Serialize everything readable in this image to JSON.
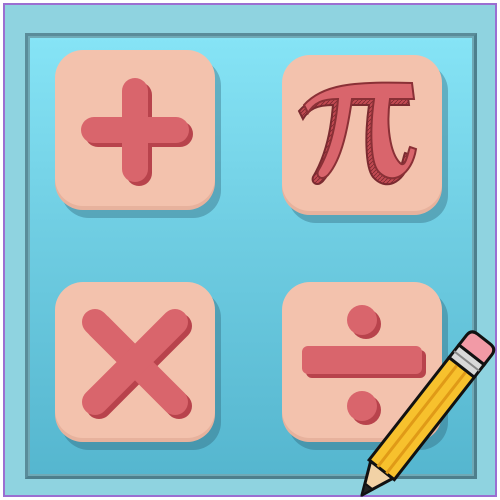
{
  "scene": {
    "tiles": [
      {
        "symbol": "plus",
        "icon": "plus-icon"
      },
      {
        "symbol": "pi",
        "icon": "pi-icon"
      },
      {
        "symbol": "multiply",
        "icon": "multiply-icon"
      },
      {
        "symbol": "divide",
        "icon": "divide-icon"
      }
    ],
    "decoration": "pencil-icon"
  },
  "colors": {
    "tile": "#f3c2ad",
    "symbol": "#d9656c",
    "symbol_shadow": "#b8434c",
    "board_top": "#86e4f6",
    "board_bottom": "#55b6cf",
    "frame": "#8fd3e0",
    "pencil_body": "#f7c12d",
    "pencil_eraser": "#f29aa6"
  }
}
